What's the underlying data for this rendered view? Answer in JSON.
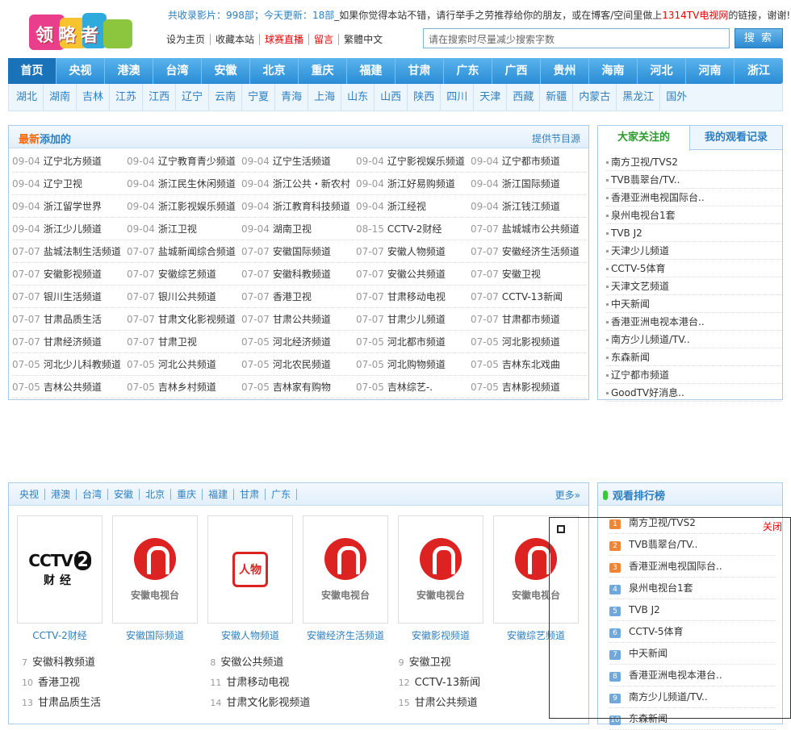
{
  "logo": {
    "text": "领略者"
  },
  "notice": {
    "prefix": "共收录影片：",
    "total": "998部",
    "today_label": "；今天更新：",
    "today": "18部",
    "text": "_如果你觉得本站不错，请行举手之劳推荐给你的朋友，或在博客/空间里做上",
    "site": "1314TV电视网",
    "suffix": "的链接，谢谢!"
  },
  "links": [
    "设为主页",
    "收藏本站",
    "球赛直播",
    "留言",
    "繁體中文"
  ],
  "search": {
    "placeholder": "请在搜索时尽量减少搜索字数",
    "button": "搜 索"
  },
  "nav1": [
    "首页",
    "央视",
    "港澳",
    "台湾",
    "安徽",
    "北京",
    "重庆",
    "福建",
    "甘肃",
    "广东",
    "广西",
    "贵州",
    "海南",
    "河北",
    "河南",
    "浙江"
  ],
  "nav2": [
    "湖北",
    "湖南",
    "吉林",
    "江苏",
    "江西",
    "辽宁",
    "云南",
    "宁夏",
    "青海",
    "上海",
    "山东",
    "山西",
    "陕西",
    "四川",
    "天津",
    "西藏",
    "新疆",
    "内蒙古",
    "黑龙江",
    "国外"
  ],
  "latest": {
    "title_hot": "最新",
    "title_rest": "添加的",
    "more": "提供节目源",
    "rows": [
      [
        [
          "09-04",
          "辽宁北方频道"
        ],
        [
          "09-04",
          "辽宁教育青少频道"
        ],
        [
          "09-04",
          "辽宁生活频道"
        ],
        [
          "09-04",
          "辽宁影视娱乐频道"
        ],
        [
          "09-04",
          "辽宁都市频道"
        ]
      ],
      [
        [
          "09-04",
          "辽宁卫视"
        ],
        [
          "09-04",
          "浙江民生休闲频道"
        ],
        [
          "09-04",
          "浙江公共・新农村"
        ],
        [
          "09-04",
          "浙江好易购频道"
        ],
        [
          "09-04",
          "浙江国际频道"
        ]
      ],
      [
        [
          "09-04",
          "浙江留学世界"
        ],
        [
          "09-04",
          "浙江影视娱乐频道"
        ],
        [
          "09-04",
          "浙江教育科技频道"
        ],
        [
          "09-04",
          "浙江经视"
        ],
        [
          "09-04",
          "浙江钱江频道"
        ]
      ],
      [
        [
          "09-04",
          "浙江少儿频道"
        ],
        [
          "09-04",
          "浙江卫视"
        ],
        [
          "09-04",
          "湖南卫视"
        ],
        [
          "08-15",
          "CCTV-2财经"
        ],
        [
          "07-07",
          "盐城城市公共频道"
        ]
      ],
      [
        [
          "07-07",
          "盐城法制生活频道"
        ],
        [
          "07-07",
          "盐城新闻综合频道"
        ],
        [
          "07-07",
          "安徽国际频道"
        ],
        [
          "07-07",
          "安徽人物频道"
        ],
        [
          "07-07",
          "安徽经济生活频道"
        ]
      ],
      [
        [
          "07-07",
          "安徽影视频道"
        ],
        [
          "07-07",
          "安徽综艺频道"
        ],
        [
          "07-07",
          "安徽科教频道"
        ],
        [
          "07-07",
          "安徽公共频道"
        ],
        [
          "07-07",
          "安徽卫视"
        ]
      ],
      [
        [
          "07-07",
          "银川生活频道"
        ],
        [
          "07-07",
          "银川公共频道"
        ],
        [
          "07-07",
          "香港卫视"
        ],
        [
          "07-07",
          "甘肃移动电视"
        ],
        [
          "07-07",
          "CCTV-13新闻"
        ]
      ],
      [
        [
          "07-07",
          "甘肃品质生活"
        ],
        [
          "07-07",
          "甘肃文化影视频道"
        ],
        [
          "07-07",
          "甘肃公共频道"
        ],
        [
          "07-07",
          "甘肃少儿频道"
        ],
        [
          "07-07",
          "甘肃都市频道"
        ]
      ],
      [
        [
          "07-07",
          "甘肃经济频道"
        ],
        [
          "07-07",
          "甘肃卫视"
        ],
        [
          "07-05",
          "河北经济频道"
        ],
        [
          "07-05",
          "河北都市频道"
        ],
        [
          "07-05",
          "河北影视频道"
        ]
      ],
      [
        [
          "07-05",
          "河北少儿科教频道"
        ],
        [
          "07-05",
          "河北公共频道"
        ],
        [
          "07-05",
          "河北农民频道"
        ],
        [
          "07-05",
          "河北购物频道"
        ],
        [
          "07-05",
          "吉林东北戏曲"
        ]
      ],
      [
        [
          "07-05",
          "吉林公共频道"
        ],
        [
          "07-05",
          "吉林乡村频道"
        ],
        [
          "07-05",
          "吉林家有购物"
        ],
        [
          "07-05",
          "吉林综艺-."
        ],
        [
          "07-05",
          "吉林影视频道"
        ]
      ]
    ]
  },
  "focus": {
    "tab_active": "大家关注的",
    "tab_other": "我的观看记录",
    "items": [
      "南方卫视/TVS2",
      "TVB翡翠台/TV..",
      "香港亚洲电视国际台..",
      "泉州电视台1套",
      "TVB J2",
      "天津少儿频道",
      "CCTV-5体育",
      "天津文艺频道",
      "中天新闻",
      "香港亚洲电视本港台..",
      "南方少儿频道/TV..",
      "东森新闻",
      "辽宁都市频道",
      "GoodTV好消息.."
    ]
  },
  "channels": {
    "nav": [
      "央视",
      "港澳",
      "台湾",
      "安徽",
      "北京",
      "重庆",
      "福建",
      "甘肃",
      "广东",
      ""
    ],
    "more": "更多»",
    "cards": [
      {
        "logo": "cctv2",
        "cctv_text": "CCTV",
        "cctv_num": "2",
        "cctv_sub": "财经",
        "caption": "CCTV-2财经"
      },
      {
        "logo": "anhui",
        "logo_text": "安徽电视台",
        "caption": "安徽国际频道"
      },
      {
        "logo": "seal",
        "logo_text": "人物",
        "caption": "安徽人物频道"
      },
      {
        "logo": "anhui",
        "logo_text": "安徽电视台",
        "caption": "安徽经济生活频道"
      },
      {
        "logo": "anhui",
        "logo_text": "安徽电视台",
        "caption": "安徽影视频道"
      },
      {
        "logo": "anhui",
        "logo_text": "安徽电视台",
        "caption": "安徽综艺频道"
      }
    ],
    "list": [
      [
        [
          "7",
          "安徽科教频道"
        ],
        [
          "8",
          "安徽公共频道"
        ],
        [
          "9",
          "安徽卫视"
        ]
      ],
      [
        [
          "10",
          "香港卫视"
        ],
        [
          "11",
          "甘肃移动电视"
        ],
        [
          "12",
          "CCTV-13新闻"
        ]
      ],
      [
        [
          "13",
          "甘肃品质生活"
        ],
        [
          "14",
          "甘肃文化影视频道"
        ],
        [
          "15",
          "甘肃公共频道"
        ]
      ]
    ]
  },
  "ranking": {
    "title": "观看排行榜",
    "items": [
      [
        "1",
        "南方卫视/TVS2"
      ],
      [
        "2",
        "TVB翡翠台/TV.."
      ],
      [
        "3",
        "香港亚洲电视国际台.."
      ],
      [
        "4",
        "泉州电视台1套"
      ],
      [
        "5",
        "TVB J2"
      ],
      [
        "6",
        "CCTV-5体育"
      ],
      [
        "7",
        "中天新闻"
      ],
      [
        "8",
        "香港亚洲电视本港台.."
      ],
      [
        "9",
        "南方少儿频道/TV.."
      ],
      [
        "10",
        "东森新闻"
      ]
    ]
  },
  "float_panel": {
    "close": "关闭"
  }
}
